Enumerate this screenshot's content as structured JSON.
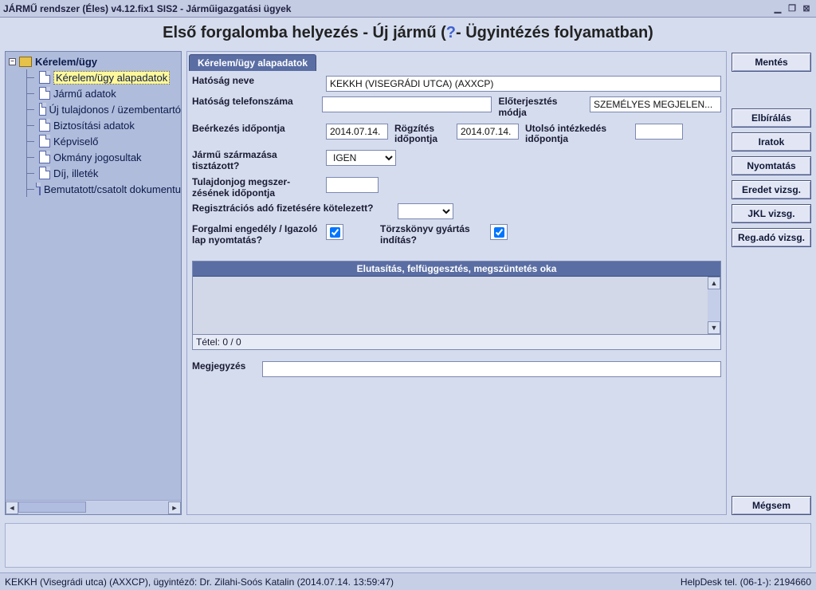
{
  "window": {
    "title": "JÁRMŰ rendszer (Éles) v4.12.fix1 SIS2 - Járműigazgatási ügyek"
  },
  "heading": {
    "prefix": "Első forgalomba helyezés - Új jármű (",
    "q": "?",
    "suffix": " - Ügyintézés folyamatban)"
  },
  "tree": {
    "root": "Kérelem/ügy",
    "items": [
      "Kérelem/ügy alapadatok",
      "Jármű adatok",
      "Új tulajdonos / üzembentartó",
      "Biztosítási adatok",
      "Képviselő",
      "Okmány jogosultak",
      "Díj, illeték",
      "Bemutatott/csatolt dokumentu"
    ]
  },
  "tab": {
    "title": "Kérelem/ügy alapadatok"
  },
  "form": {
    "hatosag_neve_lbl": "Hatóság neve",
    "hatosag_neve_val": "KEKKH (VISEGRÁDI UTCA) (AXXCP)",
    "hatosag_tel_lbl": "Hatóság telefonszáma",
    "hatosag_tel_val": "",
    "eloterj_lbl": "Előterjesztés módja",
    "eloterj_val": "SZEMÉLYES MEGJELEN...",
    "beerk_lbl": "Beérkezés időpontja",
    "beerk_val": "2014.07.14.",
    "rogz_lbl": "Rögzítés időpontja",
    "rogz_val": "2014.07.14.",
    "utolso_lbl": "Utolsó intézkedés időpontja",
    "utolso_val": "",
    "szarm_lbl": "Jármű származása tisztázott?",
    "szarm_val": "IGEN",
    "tulaj_lbl": "Tulajdonjog megszer-zésének időpontja",
    "tulaj_val": "",
    "regado_lbl": "Regisztrációs adó fizetésére kötelezett?",
    "forg_lbl": "Forgalmi engedély / Igazoló lap nyomtatás?",
    "torzs_lbl": "Törzskönyv gyártás indítás?",
    "forg_checked": true,
    "torzs_checked": true
  },
  "table": {
    "header": "Elutasítás, felfüggesztés, megszüntetés oka",
    "footer": "Tétel: 0 / 0"
  },
  "megj": {
    "label": "Megjegyzés",
    "value": ""
  },
  "buttons": {
    "mentes": "Mentés",
    "elbiralas": "Elbírálás",
    "iratok": "Iratok",
    "nyomtatas": "Nyomtatás",
    "eredet": "Eredet vizsg.",
    "jkl": "JKL vizsg.",
    "regado": "Reg.adó vizsg.",
    "megsem": "Mégsem"
  },
  "status": {
    "left": "KEKKH (Visegrádi utca) (AXXCP), ügyintéző: Dr. Zilahi-Soós Katalin (2014.07.14. 13:59:47)",
    "right": "HelpDesk tel. (06-1-): 2194660"
  }
}
